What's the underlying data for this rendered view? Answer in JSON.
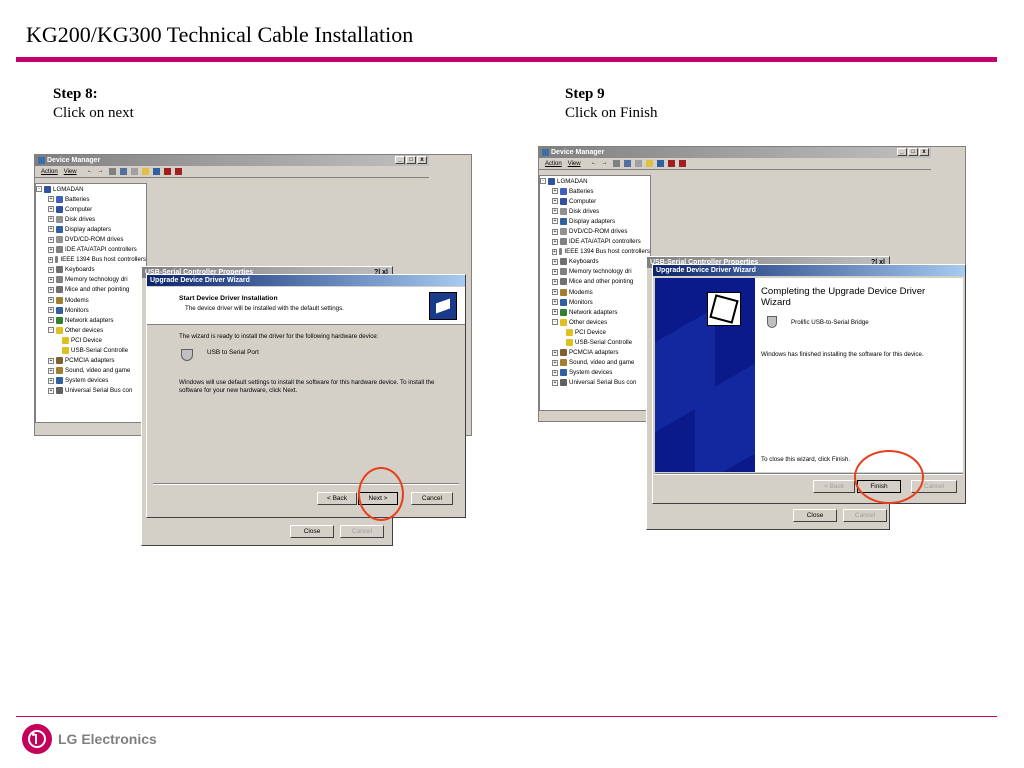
{
  "slide": {
    "title": "KG200/KG300 Technical Cable Installation",
    "footer_brand": "LG Electronics"
  },
  "accent_color": "#c4006a",
  "highlight_color": "#e8401c",
  "steps": [
    {
      "heading": "Step 8:",
      "instruction": "Click on next"
    },
    {
      "heading": "Step 9",
      "instruction": "Click on Finish"
    }
  ],
  "device_manager": {
    "title": "Device Manager",
    "menu": [
      "Action",
      "View"
    ],
    "window_buttons": [
      "_",
      "□",
      "x"
    ],
    "root": "LGMADAN",
    "items": [
      {
        "label": "Batteries",
        "icon": "battery-icon"
      },
      {
        "label": "Computer",
        "icon": "computer-icon"
      },
      {
        "label": "Disk drives",
        "icon": "disk-icon"
      },
      {
        "label": "Display adapters",
        "icon": "display-icon"
      },
      {
        "label": "DVD/CD-ROM drives",
        "icon": "cdrom-icon"
      },
      {
        "label": "IDE ATA/ATAPI controllers",
        "icon": "ide-icon"
      },
      {
        "label": "IEEE 1394 Bus host controllers",
        "icon": "firewire-icon"
      },
      {
        "label": "Keyboards",
        "icon": "keyboard-icon"
      },
      {
        "label": "Memory technology dri",
        "icon": "memory-icon"
      },
      {
        "label": "Mice and other pointing",
        "icon": "mouse-icon"
      },
      {
        "label": "Modems",
        "icon": "modem-icon"
      },
      {
        "label": "Monitors",
        "icon": "monitor-icon"
      },
      {
        "label": "Network adapters",
        "icon": "network-icon"
      },
      {
        "label": "Other devices",
        "icon": "unknown-device-icon"
      },
      {
        "label": "PCI Device",
        "icon": "unknown-device-icon",
        "child": true
      },
      {
        "label": "USB-Serial Controlle",
        "icon": "unknown-device-icon",
        "child": true
      },
      {
        "label": "PCMCIA adapters",
        "icon": "pcmcia-icon"
      },
      {
        "label": "Sound, video and game",
        "icon": "sound-icon"
      },
      {
        "label": "System devices",
        "icon": "system-icon"
      },
      {
        "label": "Universal Serial Bus con",
        "icon": "usb-icon"
      }
    ]
  },
  "properties_dialog": {
    "title": "USB-Serial Controller Properties",
    "help_close": "?| x|",
    "close_label": "Close",
    "cancel_label": "Cancel"
  },
  "wizard_step8": {
    "title": "Upgrade Device Driver Wizard",
    "header_title": "Start Device Driver Installation",
    "header_subtitle": "The device driver will be installed with the default settings.",
    "ready_text": "The wizard is ready to install the driver for the following hardware device:",
    "device_name": "USB to Serial Port",
    "info_text": "Windows will use default settings to install the software for this hardware device. To install the software for your new hardware, click Next.",
    "back_label": "< Back",
    "next_label": "Next >",
    "cancel_label": "Cancel"
  },
  "wizard_step9": {
    "title": "Upgrade Device Driver Wizard",
    "heading": "Completing the Upgrade Device Driver Wizard",
    "device_name": "Prolific USB-to-Serial Bridge",
    "finished_text": "Windows has finished installing the software for this device.",
    "close_text": "To close this wizard, click Finish.",
    "back_label": "< Back",
    "finish_label": "Finish",
    "cancel_label": "Cancel"
  }
}
